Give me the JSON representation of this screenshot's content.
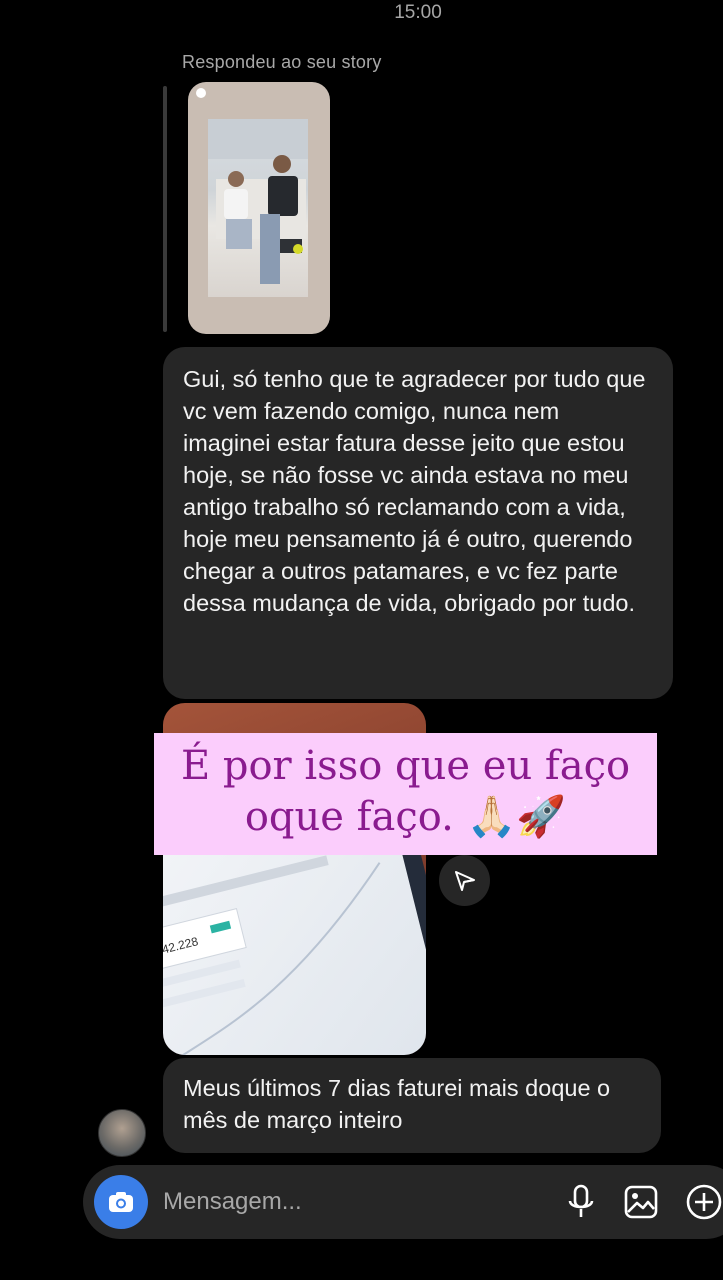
{
  "status_bar": {
    "time": "15:00"
  },
  "story_reply": {
    "caption": "Respondeu ao seu story"
  },
  "messages": [
    {
      "text": "Gui, só tenho que te agradecer por tudo que vc vem fazendo comigo, nunca nem imaginei estar fatura desse jeito que estou hoje, se não fosse vc ainda estava no meu antigo trabalho só reclamando com a vida, hoje meu pensamento já é outro, querendo chegar a outros patamares, e vc fez parte dessa mudança de vida, obrigado por tudo."
    },
    {
      "text": "Meus últimos 7 dias faturei mais doque o mês de março inteiro"
    }
  ],
  "overlay_banner": {
    "line1": "É por isso que eu faço",
    "line2": "oque faço. 🙏🏻🚀",
    "bg_color": "#fbcdfc",
    "text_color": "#8a1b8f"
  },
  "composer": {
    "placeholder": "Mensagem..."
  },
  "icons": {
    "camera": "camera-icon",
    "mic": "microphone-icon",
    "gallery": "gallery-icon",
    "add": "plus-circle-icon",
    "share": "send-icon"
  },
  "colors": {
    "bubble": "#262626",
    "camera_button": "#3a7ee8",
    "background": "#000000"
  }
}
